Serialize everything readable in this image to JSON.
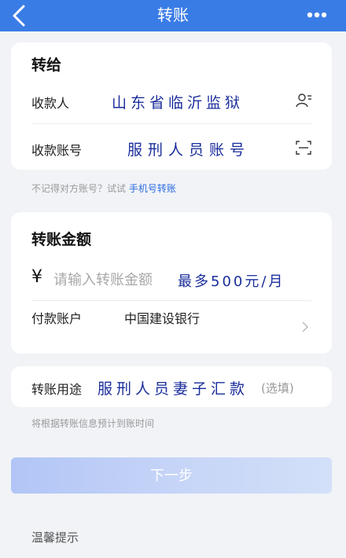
{
  "header": {
    "title": "转账",
    "back_icon": "chevron-left-icon",
    "more_icon": "more-icon",
    "bg_color": "#3a7ce6"
  },
  "payee_section": {
    "title": "转给",
    "payee_label": "收款人",
    "payee_value": "山东省临沂监狱",
    "contact_icon": "contacts-icon",
    "account_label": "收款账号",
    "account_value": "服刑人员账号",
    "scan_icon": "scan-icon"
  },
  "phone_hint": {
    "text": "不记得对方账号？试试 ",
    "link": "手机号转账"
  },
  "amount_section": {
    "title": "转账金额",
    "currency": "¥",
    "amount_placeholder": "请输入转账金额",
    "amount_note": "最多500元/月",
    "pay_account_label": "付款账户",
    "pay_account_value": "中国建设银行"
  },
  "purpose_section": {
    "label": "转账用途",
    "value": "服刑人员妻子汇款",
    "optional": "(选填)"
  },
  "arrival_hint": "将根据转账信息预计到账时间",
  "next_button": "下一步",
  "tips_label": "温馨提示",
  "colors": {
    "accent": "#2e6be0",
    "stamp_ink": "#1a2d9b"
  }
}
